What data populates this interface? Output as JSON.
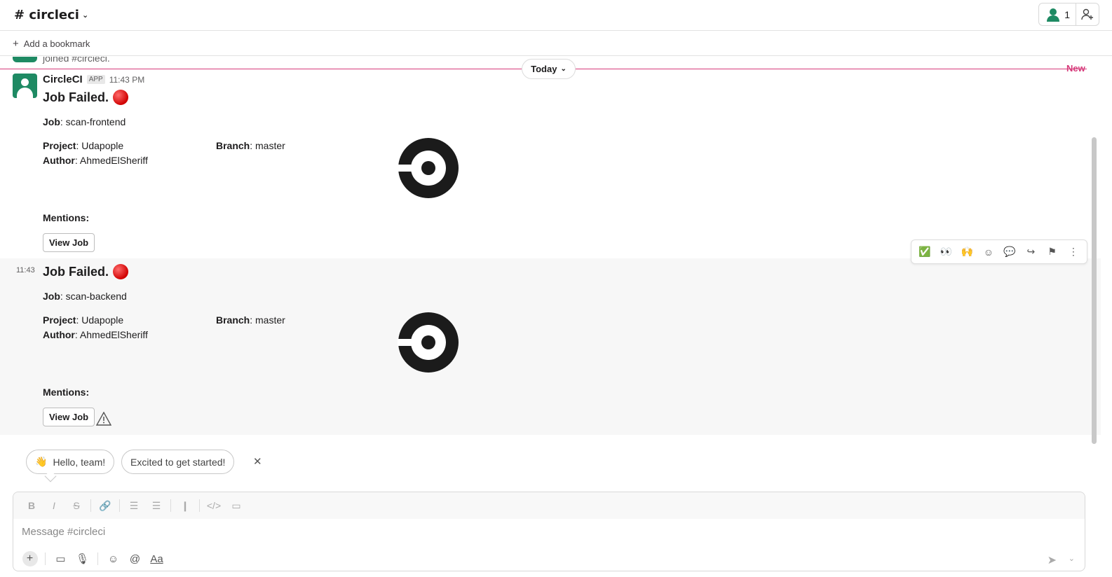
{
  "header": {
    "channel": "# circleci",
    "members_count": "1"
  },
  "bookmarks": {
    "add_label": "Add a bookmark"
  },
  "feed": {
    "joined_text": "joined #circleci.",
    "divider_label": "Today",
    "new_label": "New"
  },
  "messages": [
    {
      "sender": "CircleCI",
      "app_badge": "APP",
      "time": "11:43 PM",
      "title": "Job Failed.",
      "job_label": "Job",
      "job": "scan-frontend",
      "project_label": "Project",
      "project": "Udapople",
      "branch_label": "Branch",
      "branch": "master",
      "author_label": "Author",
      "author": "AhmedElSheriff",
      "mentions_label": "Mentions:",
      "button": "View Job"
    },
    {
      "hover_time": "11:43",
      "title": "Job Failed.",
      "job_label": "Job",
      "job": "scan-backend",
      "project_label": "Project",
      "project": "Udapople",
      "branch_label": "Branch",
      "branch": "master",
      "author_label": "Author",
      "author": "AhmedElSheriff",
      "mentions_label": "Mentions:",
      "button": "View Job"
    }
  ],
  "message_actions": [
    "white-check-mark-emoji",
    "eyes-emoji",
    "raised-hands-emoji",
    "add-reaction-icon",
    "reply-thread-icon",
    "share-icon",
    "bookmark-icon",
    "more-icon"
  ],
  "suggestions": [
    {
      "emoji": "👋",
      "label": "Hello, team!"
    },
    {
      "label": "Excited to get started!"
    }
  ],
  "composer": {
    "placeholder": "Message #circleci",
    "format_label": "Aa"
  },
  "colors": {
    "accent": "#d63a7a",
    "avatar": "#1e8a63"
  }
}
